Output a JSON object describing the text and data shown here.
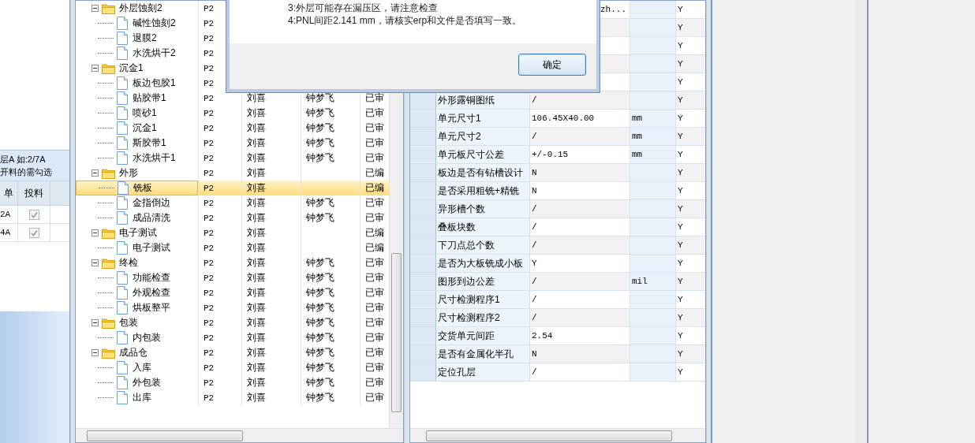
{
  "left_panel": {
    "hint_lines": [
      "层A 如:2/7A",
      "开料的需勾选"
    ],
    "columns": [
      "单",
      "投料"
    ],
    "rows": [
      {
        "column_1": "2A",
        "checked": true
      },
      {
        "column_1": "4A",
        "checked": true
      }
    ]
  },
  "tree": {
    "groups": [
      {
        "name": "外层蚀刻2",
        "p": "P2",
        "expanded": true,
        "selected": false,
        "children": [
          {
            "name": "碱性蚀刻2",
            "p": "P2",
            "selected": false
          },
          {
            "name": "退膜2",
            "p": "P2",
            "selected": false
          },
          {
            "name": "水洗烘干2",
            "p": "P2",
            "selected": false
          }
        ]
      },
      {
        "name": "沉金1",
        "p": "P2",
        "expanded": true,
        "selected": false,
        "children": [
          {
            "name": "板边包胶1",
            "p": "P2",
            "selected": false
          },
          {
            "name": "贴胶带1",
            "p": "P2",
            "author": "刘喜",
            "reviewer": "钟梦飞",
            "status": "已审",
            "selected": false
          },
          {
            "name": "喷砂1",
            "p": "P2",
            "author": "刘喜",
            "reviewer": "钟梦飞",
            "status": "已审",
            "selected": false
          },
          {
            "name": "沉金1",
            "p": "P2",
            "author": "刘喜",
            "reviewer": "钟梦飞",
            "status": "已审",
            "selected": false
          },
          {
            "name": "斯胶带1",
            "p": "P2",
            "author": "刘喜",
            "reviewer": "钟梦飞",
            "status": "已审",
            "selected": false
          },
          {
            "name": "水洗烘干1",
            "p": "P2",
            "author": "刘喜",
            "reviewer": "钟梦飞",
            "status": "已审",
            "selected": false
          }
        ]
      },
      {
        "name": "外形",
        "p": "P2",
        "author": "刘喜",
        "status": "已编",
        "expanded": true,
        "selected": false,
        "children": [
          {
            "name": "铣板",
            "p": "P2",
            "author": "刘喜",
            "status": "已编",
            "selected": true
          },
          {
            "name": "金指倒边",
            "p": "P2",
            "author": "刘喜",
            "reviewer": "钟梦飞",
            "status": "已审",
            "selected": false
          },
          {
            "name": "成品清洗",
            "p": "P2",
            "author": "刘喜",
            "reviewer": "钟梦飞",
            "status": "已审",
            "selected": false
          }
        ]
      },
      {
        "name": "电子测试",
        "p": "P2",
        "author": "刘喜",
        "status": "已编",
        "expanded": true,
        "selected": false,
        "children": [
          {
            "name": "电子测试",
            "p": "P2",
            "author": "刘喜",
            "status": "已编",
            "selected": false
          }
        ]
      },
      {
        "name": "终检",
        "p": "P2",
        "author": "刘喜",
        "reviewer": "钟梦飞",
        "status": "已审",
        "expanded": true,
        "selected": false,
        "children": [
          {
            "name": "功能检查",
            "p": "P2",
            "author": "刘喜",
            "reviewer": "钟梦飞",
            "status": "已审",
            "selected": false
          },
          {
            "name": "外观检查",
            "p": "P2",
            "author": "刘喜",
            "reviewer": "钟梦飞",
            "status": "已审",
            "selected": false
          },
          {
            "name": "烘板整平",
            "p": "P2",
            "author": "刘喜",
            "reviewer": "钟梦飞",
            "status": "已审",
            "selected": false
          }
        ]
      },
      {
        "name": "包装",
        "p": "P2",
        "author": "刘喜",
        "reviewer": "钟梦飞",
        "status": "已审",
        "expanded": true,
        "selected": false,
        "children": [
          {
            "name": "内包装",
            "p": "P2",
            "author": "刘喜",
            "reviewer": "钟梦飞",
            "status": "已审",
            "selected": false
          }
        ]
      },
      {
        "name": "成品仓",
        "p": "P2",
        "author": "刘喜",
        "reviewer": "钟梦飞",
        "status": "已审",
        "expanded": true,
        "selected": false,
        "children": [
          {
            "name": "入库",
            "p": "P2",
            "author": "刘喜",
            "reviewer": "钟梦飞",
            "status": "已审",
            "selected": false
          },
          {
            "name": "外包装",
            "p": "P2",
            "author": "刘喜",
            "reviewer": "钟梦飞",
            "status": "已审",
            "selected": false
          },
          {
            "name": "出库",
            "p": "P2",
            "author": "刘喜",
            "reviewer": "钟梦飞",
            "status": "已审",
            "selected": false
          }
        ]
      }
    ]
  },
  "dialog": {
    "lines": [
      "3:外层可能存在漏压区，请注意检查",
      "4:PNL间距2.141 mm，请核实erp和文件是否填写一致。"
    ],
    "button": "确定"
  },
  "properties": [
    {
      "kind": "fragment",
      "value": "zh...",
      "flag": "Y"
    },
    {
      "kind": "hidden",
      "flag": "Y"
    },
    {
      "kind": "hidden",
      "flag": "Y"
    },
    {
      "kind": "hidden",
      "flag": "Y"
    },
    {
      "kind": "hidden",
      "flag": "Y"
    },
    {
      "kind": "full",
      "name": "外形露铜图纸",
      "value": "/",
      "flag": "Y"
    },
    {
      "kind": "full",
      "name": "单元尺寸1",
      "value": "106.45X40.00",
      "unit": "mm",
      "flag": "Y"
    },
    {
      "kind": "full",
      "name": "单元尺寸2",
      "value": "/",
      "unit": "mm",
      "flag": "Y"
    },
    {
      "kind": "full",
      "name": "单元板尺寸公差",
      "value": "+/-0.15",
      "unit": "mm",
      "flag": "Y"
    },
    {
      "kind": "full",
      "name": "板边是否有钻槽设计",
      "value": "N",
      "flag": "Y"
    },
    {
      "kind": "full",
      "name": "是否采用粗铣+精铣",
      "value": "N",
      "flag": "Y"
    },
    {
      "kind": "full",
      "name": "异形槽个数",
      "value": "/",
      "flag": "Y"
    },
    {
      "kind": "full",
      "name": "叠板块数",
      "value": "/",
      "flag": "Y"
    },
    {
      "kind": "full",
      "name": "下刀点总个数",
      "value": "/",
      "flag": "Y"
    },
    {
      "kind": "full",
      "name": "是否为大板铣成小板",
      "value": "Y",
      "flag": "Y"
    },
    {
      "kind": "full",
      "name": "图形到边公差",
      "value": "/",
      "unit": "mil",
      "flag": "Y"
    },
    {
      "kind": "full",
      "name": "尺寸检测程序1",
      "value": "/",
      "flag": "Y"
    },
    {
      "kind": "full",
      "name": "尺寸检测程序2",
      "value": "/",
      "flag": "Y"
    },
    {
      "kind": "full",
      "name": "交货单元间距",
      "value": "2.54",
      "flag": "Y"
    },
    {
      "kind": "full",
      "name": "是否有金属化半孔",
      "value": "N",
      "flag": "Y"
    },
    {
      "kind": "full",
      "name": "定位孔层",
      "value": "/",
      "flag": "Y"
    }
  ]
}
